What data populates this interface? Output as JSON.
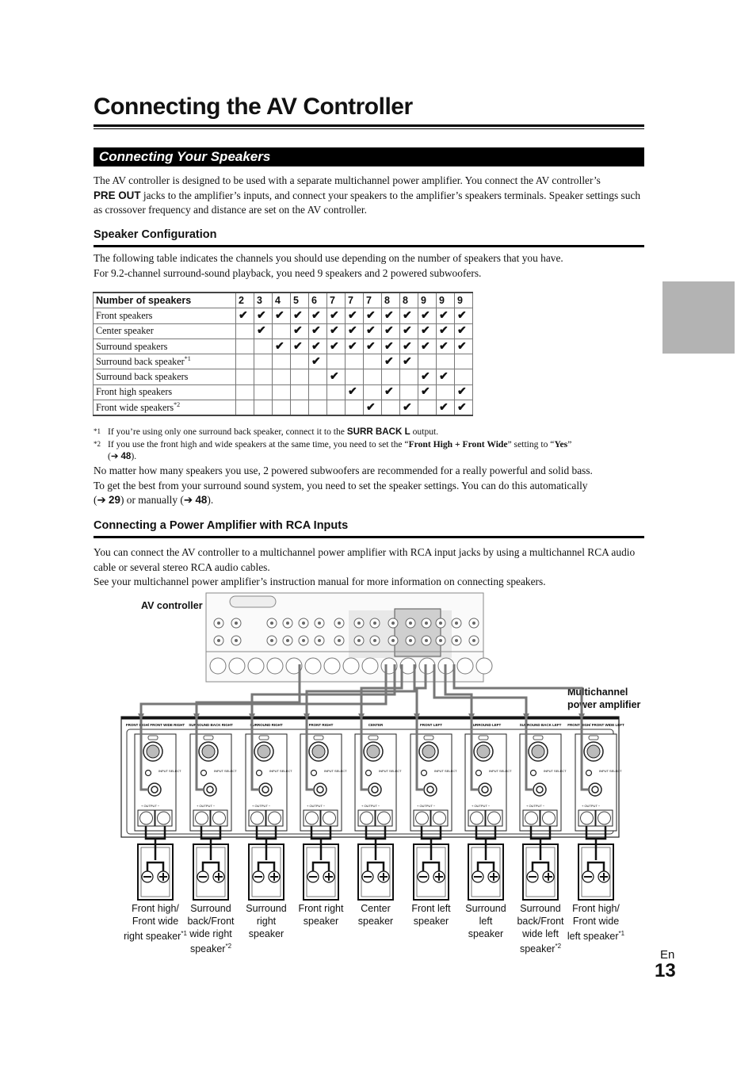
{
  "page": {
    "title": "Connecting the AV Controller",
    "section_title": "Connecting Your Speakers",
    "intro": {
      "p1_a": "The AV controller is designed to be used with a separate multichannel power amplifier. You connect the AV controller’s",
      "p1_bold": "PRE OUT",
      "p1_b": " jacks to the amplifier’s inputs, and connect your speakers to the amplifier’s speakers terminals. Speaker settings such as crossover frequency and distance are set on the AV controller."
    },
    "speaker_config": {
      "heading": "Speaker Configuration",
      "line1": "The following table indicates the channels you should use depending on the number of speakers that you have.",
      "line2": "For 9.2-channel surround-sound playback, you need 9 speakers and 2 powered subwoofers."
    },
    "table": {
      "header_label": "Number of speakers",
      "columns": [
        "2",
        "3",
        "4",
        "5",
        "6",
        "7",
        "7",
        "7",
        "8",
        "8",
        "9",
        "9",
        "9"
      ],
      "check_glyph": "✔",
      "rows": [
        {
          "label": "Front speakers",
          "sup": "",
          "checks": [
            1,
            1,
            1,
            1,
            1,
            1,
            1,
            1,
            1,
            1,
            1,
            1,
            1
          ]
        },
        {
          "label": "Center speaker",
          "sup": "",
          "checks": [
            0,
            1,
            0,
            1,
            1,
            1,
            1,
            1,
            1,
            1,
            1,
            1,
            1
          ]
        },
        {
          "label": "Surround speakers",
          "sup": "",
          "checks": [
            0,
            0,
            1,
            1,
            1,
            1,
            1,
            1,
            1,
            1,
            1,
            1,
            1
          ]
        },
        {
          "label": "Surround back speaker",
          "sup": "*1",
          "checks": [
            0,
            0,
            0,
            0,
            1,
            0,
            0,
            0,
            1,
            1,
            0,
            0,
            0
          ]
        },
        {
          "label": "Surround back speakers",
          "sup": "",
          "checks": [
            0,
            0,
            0,
            0,
            0,
            1,
            0,
            0,
            0,
            0,
            1,
            1,
            0
          ]
        },
        {
          "label": "Front high speakers",
          "sup": "",
          "checks": [
            0,
            0,
            0,
            0,
            0,
            0,
            1,
            0,
            1,
            0,
            1,
            0,
            1
          ]
        },
        {
          "label": "Front wide speakers",
          "sup": "*2",
          "checks": [
            0,
            0,
            0,
            0,
            0,
            0,
            0,
            1,
            0,
            1,
            0,
            1,
            1
          ]
        }
      ]
    },
    "footnotes": {
      "fn1_mark": "*1",
      "fn1_a": "If you’re using only one surround back speaker, connect it to the ",
      "fn1_bold": "SURR BACK L",
      "fn1_b": " output.",
      "fn2_mark": "*2",
      "fn2_a": "If you use the front high and wide speakers at the same time, you need to set the “",
      "fn2_bold1": "Front High + Front Wide",
      "fn2_b": "” setting to “",
      "fn2_bold2": "Yes",
      "fn2_c": "”",
      "fn2_ref_open": "(➔ ",
      "fn2_ref": "48",
      "fn2_ref_close": ")."
    },
    "subwoofer_note": "No matter how many speakers you use, 2 powered subwoofers are recommended for a really powerful and solid bass.",
    "settings_note": {
      "a": "To get the best from your surround sound system, you need to set the speaker settings. You can do this automatically",
      "ref1_open": "(➔ ",
      "ref1": "29",
      "mid": ") or manually (➔ ",
      "ref2": "48",
      "end": ")."
    },
    "rca": {
      "heading": "Connecting a Power Amplifier with RCA Inputs",
      "p1": "You can connect the AV controller to a multichannel power amplifier with RCA input jacks by using a multichannel RCA audio cable or several stereo RCA audio cables.",
      "p2": "See your multichannel power amplifier’s instruction manual for more information on connecting speakers."
    },
    "diagram": {
      "av_controller_label": "AV controller",
      "amp_label_line1": "Multichannel",
      "amp_label_line2": "power amplifier",
      "amp_channels": [
        {
          "top": "FRONT HIGH/ FRONT WIDE RIGHT"
        },
        {
          "top": "SURROUND BACK RIGHT"
        },
        {
          "top": "SURROUND RIGHT"
        },
        {
          "top": "FRONT RIGHT"
        },
        {
          "top": "CENTER"
        },
        {
          "top": "FRONT LEFT"
        },
        {
          "top": "SURROUND LEFT"
        },
        {
          "top": "SURROUND BACK LEFT"
        },
        {
          "top": "FRONT HIGH/ FRONT WIDE LEFT"
        }
      ],
      "input_select_label": "INPUT SELECT",
      "output_label": "OUTPUT",
      "speakers": [
        {
          "l1": "Front high/",
          "l2": "Front wide",
          "l3": "right speaker",
          "sup": "*1",
          "l4": ""
        },
        {
          "l1": "Surround",
          "l2": "back/Front",
          "l3": "wide right",
          "l4": "speaker",
          "sup4": "*2"
        },
        {
          "l1": "Surround",
          "l2": "right",
          "l3": "speaker",
          "l4": ""
        },
        {
          "l1": "Front right",
          "l2": "speaker",
          "l3": "",
          "l4": ""
        },
        {
          "l1": "Center",
          "l2": "speaker",
          "l3": "",
          "l4": ""
        },
        {
          "l1": "Front left",
          "l2": "speaker",
          "l3": "",
          "l4": ""
        },
        {
          "l1": "Surround",
          "l2": "left",
          "l3": "speaker",
          "l4": ""
        },
        {
          "l1": "Surround",
          "l2": "back/Front",
          "l3": "wide left",
          "l4": "speaker",
          "sup4": "*2"
        },
        {
          "l1": "Front high/",
          "l2": "Front wide",
          "l3": "left speaker",
          "sup": "*1",
          "l4": ""
        }
      ]
    },
    "footer": {
      "lang": "En",
      "page_number": "13"
    }
  }
}
